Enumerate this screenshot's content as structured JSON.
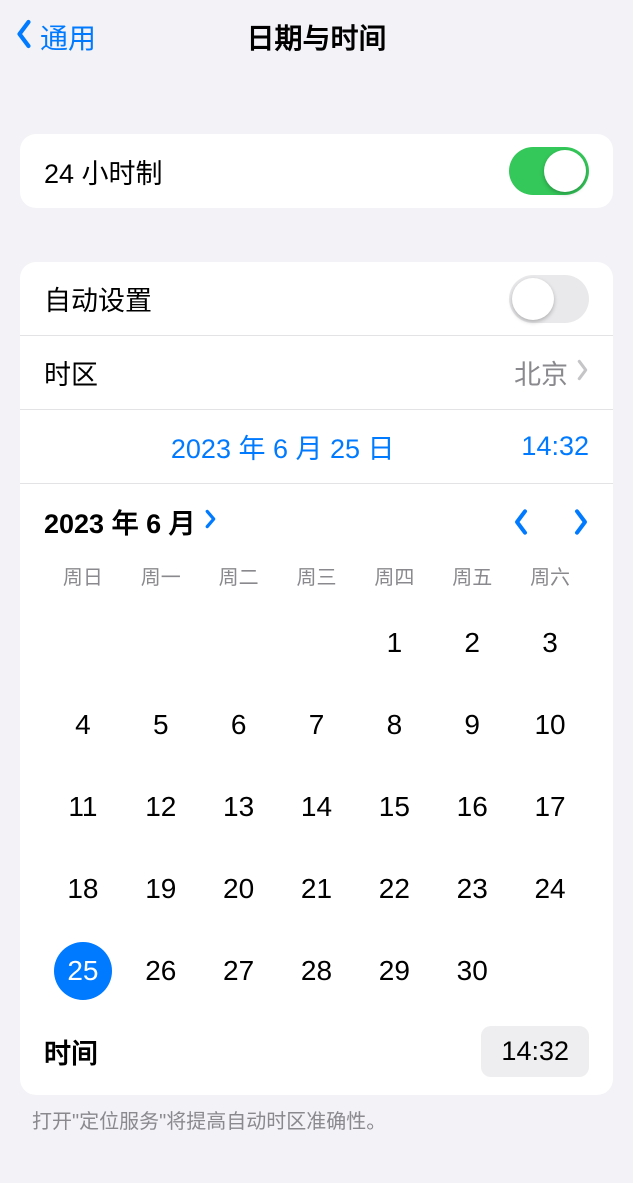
{
  "header": {
    "back_label": "通用",
    "title": "日期与时间"
  },
  "group1": {
    "hour24_label": "24 小时制",
    "hour24_on": true
  },
  "group2": {
    "auto_label": "自动设置",
    "auto_on": false,
    "timezone_label": "时区",
    "timezone_value": "北京",
    "selected_date": "2023 年 6 月 25 日",
    "selected_time": "14:32",
    "calendar": {
      "month_label": "2023 年 6 月",
      "weekdays": [
        "周日",
        "周一",
        "周二",
        "周三",
        "周四",
        "周五",
        "周六"
      ],
      "leading_blanks": 4,
      "days": [
        1,
        2,
        3,
        4,
        5,
        6,
        7,
        8,
        9,
        10,
        11,
        12,
        13,
        14,
        15,
        16,
        17,
        18,
        19,
        20,
        21,
        22,
        23,
        24,
        25,
        26,
        27,
        28,
        29,
        30
      ],
      "selected_day": 25
    },
    "time_label": "时间",
    "time_value": "14:32"
  },
  "footer": "打开\"定位服务\"将提高自动时区准确性。"
}
